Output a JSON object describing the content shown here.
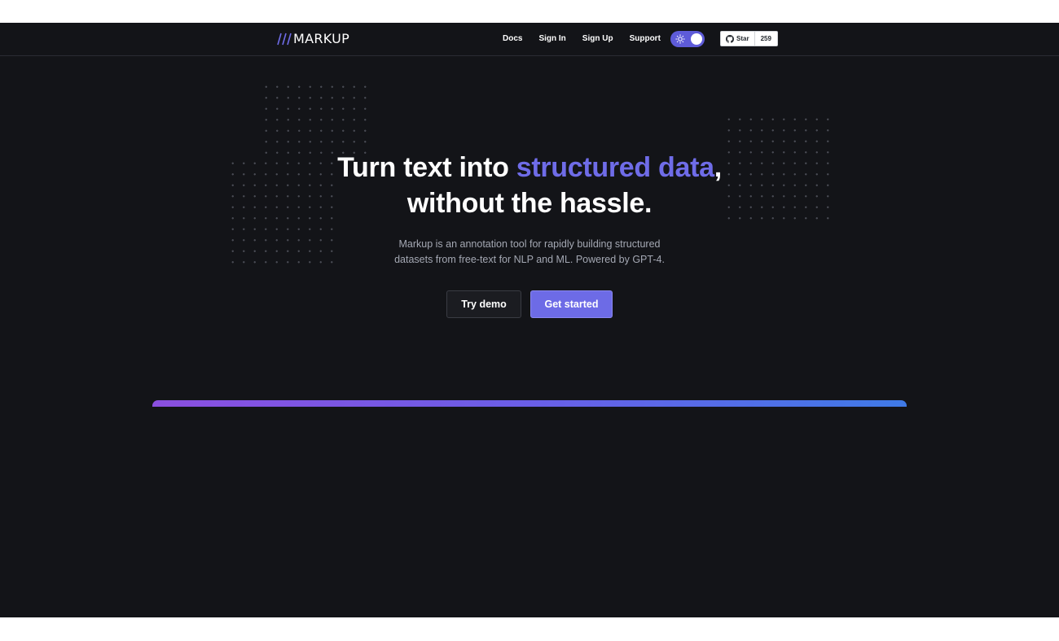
{
  "nav": {
    "logo_text": "MARKUP",
    "links": [
      {
        "label": "Docs"
      },
      {
        "label": "Sign In"
      },
      {
        "label": "Sign Up"
      },
      {
        "label": "Support"
      }
    ],
    "theme_toggle": {
      "icon": "sun-icon",
      "state": "on"
    },
    "github": {
      "star_label": "Star",
      "star_count": "259",
      "icon": "github-icon"
    }
  },
  "hero": {
    "title_part1": "Turn text into ",
    "title_accent": "structured data",
    "title_part2": ",",
    "title_line2": "without the hassle.",
    "subtitle_line1": "Markup is an annotation tool for rapidly building structured",
    "subtitle_line2": "datasets from free-text for NLP and ML. Powered by GPT-4.",
    "try_demo_label": "Try demo",
    "get_started_label": "Get started"
  },
  "colors": {
    "background": "#131418",
    "accent": "#6f6ce8",
    "toggle": "#5e5bd9",
    "primary_button": "#6d6be6",
    "gradient_start": "#8b4fe0",
    "gradient_end": "#3f7ae6"
  }
}
